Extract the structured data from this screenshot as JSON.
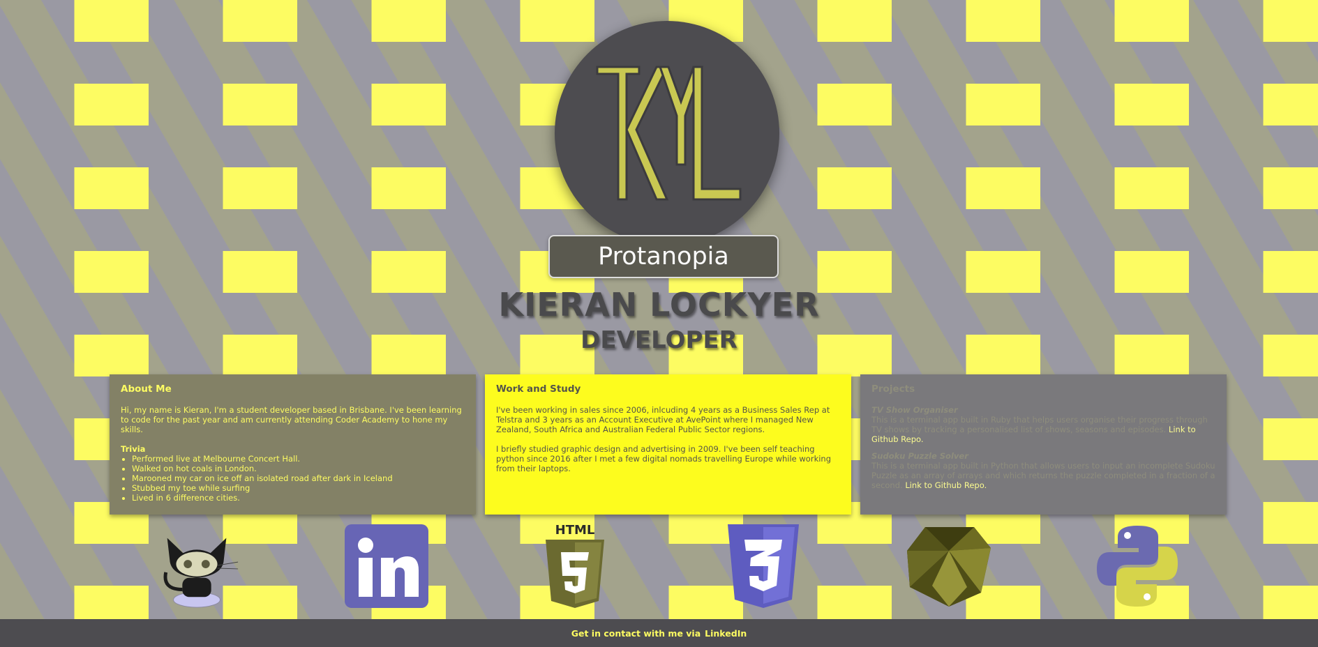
{
  "theme": {
    "mode_label": "Protanopia",
    "accent": "#fdfc62",
    "dark": "#4d4c50"
  },
  "header": {
    "logo": "KYL",
    "name": "KIERAN LOCKYER",
    "role": "DEVELOPER"
  },
  "about": {
    "title": "About Me",
    "intro": "Hi, my name is Kieran, I'm a student developer based in Brisbane. I've been learning to code for the past year and am currently attending Coder Academy to hone my skills.",
    "trivia_title": "Trivia",
    "trivia": [
      "Performed live at Melbourne Concert Hall.",
      "Walked on hot coals in London.",
      "Marooned my car on ice off an isolated road after dark in Iceland",
      "Stubbed my toe while surfing",
      "Lived in 6 difference cities."
    ]
  },
  "work": {
    "title": "Work and Study",
    "paragraphs": [
      "I've been working in sales since 2006, inlcuding 4 years as a Business Sales Rep at Telstra and 3 years as an Account Executive at AvePoint where I managed New Zealand, South Africa and Australian Federal Public Sector regions.",
      "I briefly studied graphic design and advertising in 2009. I've been self teaching python since 2016 after I met a few digital nomads travelling Europe while working from their laptops."
    ]
  },
  "projects": {
    "title": "Projects",
    "items": [
      {
        "name": "TV Show Organiser",
        "desc": "This is a terminal app built in Ruby that helps users organise their progress through TV shows by tracking a personalised list of shows, seasons and episodes.",
        "link": "Link to Github Repo."
      },
      {
        "name": "Sudoku Puzzle Solver",
        "desc": "This is a terminal app built in Python that allows users to input an incomplete Sudoku Puzzle as an array of arrays and which returns the puzzle completed in a fraction of a second.",
        "link": "Link to Github Repo."
      }
    ]
  },
  "icons": [
    "github-icon",
    "linkedin-icon",
    "html5-icon",
    "css3-icon",
    "ruby-icon",
    "python-icon"
  ],
  "icon_labels": {
    "html5": "HTML"
  },
  "footer": {
    "text": "Get in contact with me via",
    "link": "LinkedIn"
  }
}
